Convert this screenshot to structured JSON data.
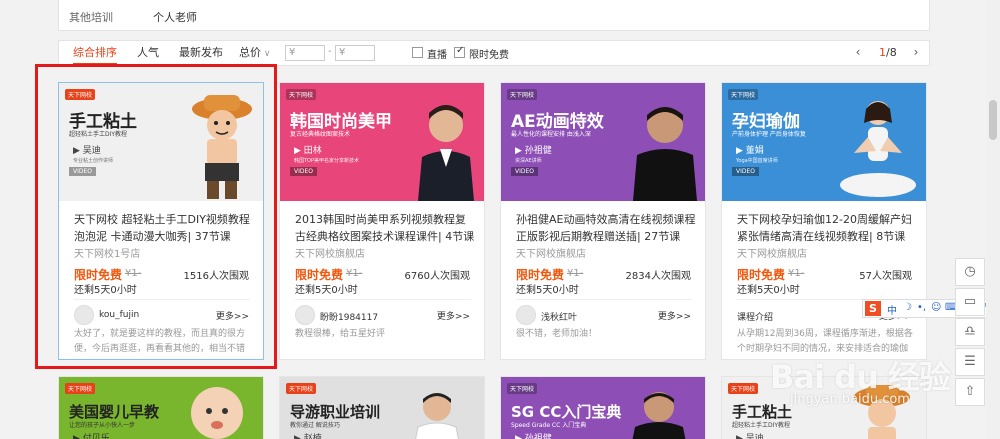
{
  "filter": {
    "label": "其他培训",
    "value": "个人老师"
  },
  "sortbar": {
    "items": [
      "综合排序",
      "人气",
      "最新发布",
      "总价"
    ],
    "price_min": "¥",
    "price_max": "¥",
    "price_sep": "-",
    "live_label": "直播",
    "free_label": "限时免费",
    "page_current": "1",
    "page_total": "/8"
  },
  "cards": [
    {
      "banner_title": "手工粘土",
      "banner_sub": "超轻粘土手工DIY教程",
      "banner_teacher": "▶ 吴迪",
      "banner_teacher_desc": "专业粘土创作讲师",
      "banner_video": "VIDEO",
      "banner_color": "#f0f0f0",
      "banner_text_color": "#222",
      "title": "天下网校 超轻粘土手工DIY视频教程 泡泡泥 卡通动漫大咖秀| 37节课",
      "shop": "天下网校1号店",
      "free": "限时免费",
      "old_price": "¥1-",
      "views": "1516人次围观",
      "remain": "还剩5天0小时",
      "user": "kou_fujin",
      "more": "更多>>",
      "comment": "太好了，就是要这样的教程，而且真的很方便，今后再逛逛，再看看其他的，相当不错"
    },
    {
      "banner_title": "韩国时尚美甲",
      "banner_sub": "复古经典格纹图案技术",
      "banner_teacher": "▶ 田林",
      "banner_teacher_desc": "韩国TOP美甲名家分享新技术",
      "banner_video": "VIDEO",
      "banner_color": "#e8457a",
      "banner_text_color": "#fff",
      "title": "2013韩国时尚美甲系列视频教程复古经典格纹图案技术课程课件| 4节课",
      "shop": "天下网校旗舰店",
      "free": "限时免费",
      "old_price": "¥1-",
      "views": "6760人次围观",
      "remain": "还剩5天0小时",
      "user": "盼盼1984117",
      "more": "更多>>",
      "comment": "教程很棒，给五星好评"
    },
    {
      "banner_title": "AE动画特效",
      "banner_sub": "最人性化的课程安排 由浅入深",
      "banner_teacher": "▶ 孙祖健",
      "banner_teacher_desc": "资深AE讲师",
      "banner_video": "VIDEO",
      "banner_color": "#8d4fb5",
      "banner_text_color": "#fff",
      "title": "孙祖健AE动画特效高清在线视频课程正版影视后期教程赠送插| 27节课",
      "shop": "天下网校旗舰店",
      "free": "限时免费",
      "old_price": "¥1-",
      "views": "2834人次围观",
      "remain": "还剩5天0小时",
      "user": "浅秋红叶",
      "more": "更多>>",
      "comment": "很不错，老师加油！"
    },
    {
      "banner_title": "孕妇瑜伽",
      "banner_sub": "产前身体护理 产后身体恢复",
      "banner_teacher": "▶ 董娟",
      "banner_teacher_desc": "Yoga中国首席讲师",
      "banner_video": "VIDEO",
      "banner_color": "#3b8fd6",
      "banner_text_color": "#fff",
      "title": "天下网校孕妇瑜伽12-20周缓解产妇紧张情绪高清在线视频教程| 8节课",
      "shop": "天下网校旗舰店",
      "free": "限时免费",
      "old_price": "¥1-",
      "views": "57人次围观",
      "remain": "还剩5天0小时",
      "user": "课程介绍",
      "more": "更多>>",
      "comment": "从孕期12周到36周，课程循序渐进，根据各个时期孕妇不同的情况，来安排适合的瑜伽"
    }
  ],
  "cards_row2": [
    {
      "title": "美国婴儿早教",
      "sub": "让您的孩子从小快人一步",
      "teacher": "▶ 付贝乐",
      "color": "#7ab52e"
    },
    {
      "title": "导游职业培训",
      "sub": "教你通过 解说技巧",
      "teacher": "▶ 赵楠",
      "color": "#e0e0e0"
    },
    {
      "title": "SG CC入门宝典",
      "sub": "Speed Grade CC 入门宝典",
      "teacher": "▶ 孙祖健",
      "color": "#8d4fb5"
    },
    {
      "title": "手工粘土",
      "sub": "超轻粘土手工DIY教程",
      "teacher": "▶ 吴迪",
      "color": "#f0f0f0"
    }
  ],
  "ime": {
    "logo": "S",
    "mode": "中"
  },
  "watermark": {
    "brand": "Bai du 经验",
    "url": "jingyan.baidu.com"
  }
}
